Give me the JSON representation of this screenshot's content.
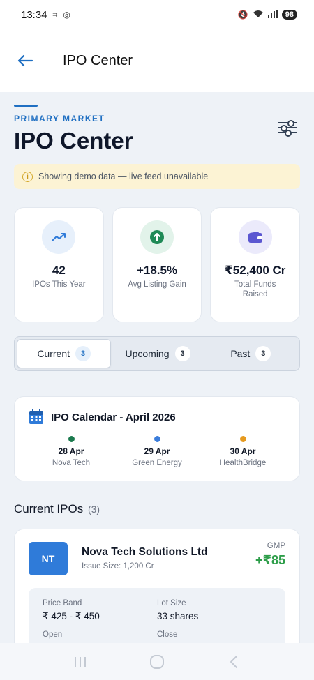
{
  "status": {
    "time": "13:34",
    "battery": "98"
  },
  "appbar": {
    "title": "IPO Center"
  },
  "header": {
    "eyebrow": "PRIMARY MARKET",
    "title": "IPO Center"
  },
  "banner": {
    "text": "Showing demo data — live feed unavailable"
  },
  "stats": [
    {
      "value": "42",
      "label": "IPOs This Year",
      "icon": "trending-up-icon",
      "icon_color": "#2f7bd9",
      "icon_bg": "#e7f0fb"
    },
    {
      "value": "+18.5%",
      "label": "Avg Listing Gain",
      "icon": "arrow-up-circle-icon",
      "icon_color": "#1f8a56",
      "icon_bg": "#e2f3ea"
    },
    {
      "value": "₹52,400 Cr",
      "label": "Total Funds Raised",
      "icon": "wallet-icon",
      "icon_color": "#5b57d1",
      "icon_bg": "#ebeafb"
    }
  ],
  "tabs": [
    {
      "label": "Current",
      "count": "3",
      "active": true
    },
    {
      "label": "Upcoming",
      "count": "3",
      "active": false
    },
    {
      "label": "Past",
      "count": "3",
      "active": false
    }
  ],
  "calendar": {
    "title": "IPO Calendar - April 2026",
    "items": [
      {
        "date": "28 Apr",
        "name": "Nova Tech",
        "color": "#1b7a4e"
      },
      {
        "date": "29 Apr",
        "name": "Green Energy",
        "color": "#3b7ddb"
      },
      {
        "date": "30 Apr",
        "name": "HealthBridge",
        "color": "#e69a1f"
      }
    ]
  },
  "section": {
    "title": "Current IPOs",
    "count": "(3)"
  },
  "ipo": {
    "logo": "NT",
    "logo_color": "#2f7bd9",
    "name": "Nova Tech Solutions Ltd",
    "issue_size": "Issue Size: 1,200 Cr",
    "gmp_label": "GMP",
    "gmp_value": "+₹85",
    "price_band_label": "Price Band",
    "price_band": "₹ 425 - ₹ 450",
    "lot_size_label": "Lot Size",
    "lot_size": "33 shares",
    "open_label": "Open",
    "close_label": "Close"
  },
  "colors": {
    "accent": "#1f6fc2",
    "gain": "#2e9e4a"
  }
}
